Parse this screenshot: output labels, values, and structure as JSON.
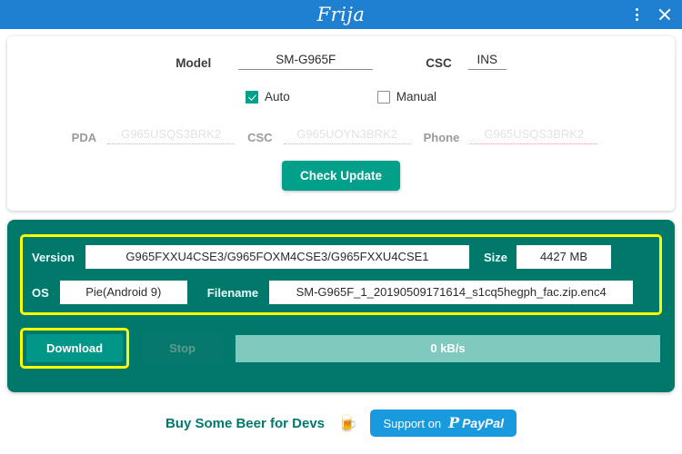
{
  "window": {
    "title": "Frija",
    "menu_icon": "vertical-dots-icon",
    "close_icon": "close-icon"
  },
  "form": {
    "model_label": "Model",
    "model_value": "SM-G965F",
    "csc_label": "CSC",
    "csc_value": "INS",
    "auto_label": "Auto",
    "auto_checked": true,
    "manual_label": "Manual",
    "manual_checked": false,
    "pda_label": "PDA",
    "pda_placeholder": "G965USQS3BRK2",
    "csc_fw_label": "CSC",
    "csc_fw_placeholder": "G965UOYN3BRK2",
    "phone_label": "Phone",
    "phone_placeholder": "G965USQS3BRK2",
    "check_update_label": "Check Update"
  },
  "firmware": {
    "version_label": "Version",
    "version_value": "G965FXXU4CSE3/G965FOXM4CSE3/G965FXXU4CSE1",
    "size_label": "Size",
    "size_value": "4427 MB",
    "os_label": "OS",
    "os_value": "Pie(Android 9)",
    "filename_label": "Filename",
    "filename_value": "SM-G965F_1_20190509171614_s1cq5hegph_fac.zip.enc4"
  },
  "actions": {
    "download_label": "Download",
    "stop_label": "Stop",
    "progress_text": "0 kB/s"
  },
  "footer": {
    "beer_text": "Buy Some Beer for Devs",
    "beer_icon": "🍺",
    "paypal_support_text": "Support on",
    "paypal_mark": "P",
    "paypal_word": "PayPal"
  },
  "colors": {
    "titlebar_blue": "#1f7fd0",
    "teal_panel": "#00796b",
    "accent_teal": "#00a08a",
    "highlight_yellow": "#fbff00",
    "progress_bar": "#80c9bf",
    "paypal_blue": "#1a9ade"
  }
}
